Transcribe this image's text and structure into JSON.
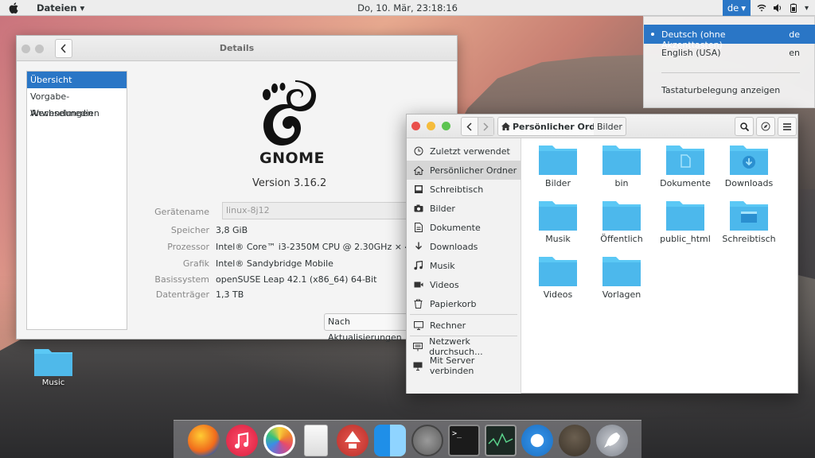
{
  "topbar": {
    "app_menu": "Dateien",
    "clock": "Do, 10. Mär, 23:18:16",
    "lang_indicator": "de"
  },
  "lang_popup": {
    "items": [
      {
        "label": "Deutsch (ohne Akzenttasten)",
        "code": "de",
        "selected": true
      },
      {
        "label": "English (USA)",
        "code": "en",
        "selected": false
      }
    ],
    "show_layout": "Tastaturbelegung anzeigen"
  },
  "details": {
    "title": "Details",
    "sidebar": [
      "Übersicht",
      "Vorgabe-Anwendungen",
      "Wechselmedien"
    ],
    "logo_text": "GNOME",
    "version": "Version 3.16.2",
    "hostname_label": "Gerätename",
    "hostname_value": "linux-8j12",
    "rows": [
      {
        "key": "Speicher",
        "value": "3,8 GiB"
      },
      {
        "key": "Prozessor",
        "value": "Intel® Core™ i3-2350M CPU @ 2.30GHz × 4"
      },
      {
        "key": "Grafik",
        "value": "Intel® Sandybridge Mobile"
      },
      {
        "key": "Basissystem",
        "value": "openSUSE Leap 42.1 (x86_64) 64-Bit"
      },
      {
        "key": "Datenträger",
        "value": "1,3 TB"
      }
    ],
    "update_button": "Nach Aktualisierungen"
  },
  "files": {
    "breadcrumb_home": "Persönlicher Ordner",
    "breadcrumb_sub": "Bilder",
    "sidebar": [
      {
        "label": "Zuletzt verwendet",
        "icon": "clock-icon"
      },
      {
        "label": "Persönlicher Ordner",
        "icon": "home-icon"
      },
      {
        "label": "Schreibtisch",
        "icon": "desktop-icon"
      },
      {
        "label": "Bilder",
        "icon": "camera-icon"
      },
      {
        "label": "Dokumente",
        "icon": "document-icon"
      },
      {
        "label": "Downloads",
        "icon": "download-icon"
      },
      {
        "label": "Musik",
        "icon": "music-icon"
      },
      {
        "label": "Videos",
        "icon": "video-icon"
      },
      {
        "label": "Papierkorb",
        "icon": "trash-icon"
      },
      {
        "label": "Rechner",
        "icon": "computer-icon"
      },
      {
        "label": "Netzwerk durchsuch...",
        "icon": "network-icon"
      },
      {
        "label": "Mit Server verbinden",
        "icon": "server-icon"
      }
    ],
    "folders": [
      "Bilder",
      "bin",
      "Dokumente",
      "Downloads",
      "Musik",
      "Öffentlich",
      "public_html",
      "Schreibtisch",
      "Videos",
      "Vorlagen"
    ]
  },
  "desktop": {
    "icon_label": "Music"
  },
  "colors": {
    "accent": "#2a76c6",
    "folder": "#5bc8f5"
  }
}
